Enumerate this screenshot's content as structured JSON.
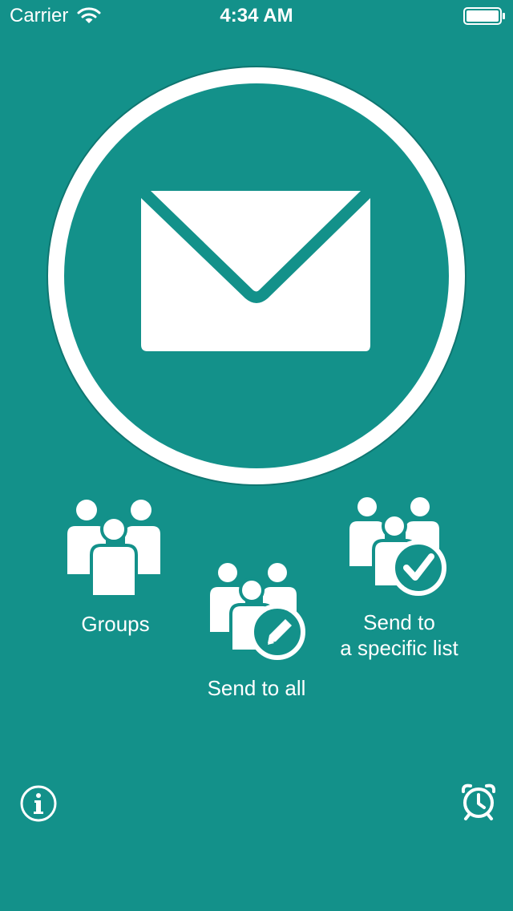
{
  "status_bar": {
    "carrier": "Carrier",
    "time": "4:34 AM"
  },
  "colors": {
    "background": "#13918a",
    "foreground": "#ffffff"
  },
  "main": {
    "mail_icon": "envelope-icon"
  },
  "actions": {
    "groups": {
      "label": "Groups",
      "icon": "people-group-icon"
    },
    "send_all": {
      "label": "Send to all",
      "icon": "people-edit-icon"
    },
    "send_list": {
      "line1": "Send to",
      "line2": "a specific list",
      "icon": "people-check-icon"
    }
  },
  "footer": {
    "info_icon": "info-icon",
    "alarm_icon": "alarm-clock-icon"
  }
}
